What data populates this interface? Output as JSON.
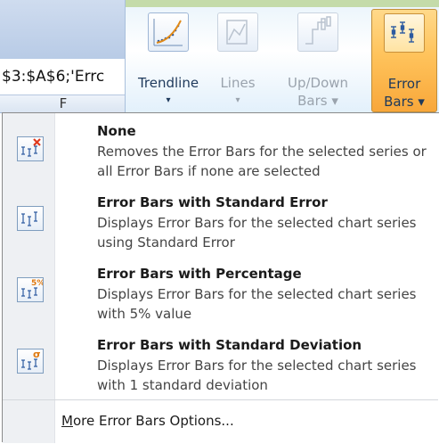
{
  "formula_bar": {
    "text": "$3:$A$6;'Errc"
  },
  "column_header": {
    "letter": "F"
  },
  "ribbon": {
    "buttons": [
      {
        "id": "trendline",
        "line1": "Trendline",
        "line2": "▾",
        "enabled": true,
        "icon": "trendline-icon"
      },
      {
        "id": "lines",
        "line1": "Lines",
        "line2": "▾",
        "enabled": false,
        "icon": "lines-icon"
      },
      {
        "id": "updown",
        "line1": "Up/Down",
        "line2": "Bars ▾",
        "enabled": false,
        "icon": "up-down-bars-icon"
      },
      {
        "id": "errorbars",
        "line1": "Error",
        "line2": "Bars ▾",
        "enabled": true,
        "selected": true,
        "icon": "error-bars-icon"
      }
    ]
  },
  "menu": {
    "items": [
      {
        "title": "None",
        "description": "Removes the Error Bars for the selected series or all Error Bars if none are selected",
        "icon": "error-bars-none-icon"
      },
      {
        "title": "Error Bars with Standard Error",
        "description": "Displays Error Bars for the selected chart series using Standard Error",
        "icon": "error-bars-standard-error-icon"
      },
      {
        "title": "Error Bars with Percentage",
        "description": "Displays Error Bars for the selected chart series with 5% value",
        "icon": "error-bars-percentage-icon",
        "icon_badge": "5%"
      },
      {
        "title": "Error Bars with Standard Deviation",
        "description": "Displays Error Bars for the selected chart series with 1 standard deviation",
        "icon": "error-bars-standard-deviation-icon",
        "icon_badge": "σ"
      }
    ],
    "more_options": {
      "accelerator": "M",
      "rest": "ore Error Bars Options..."
    }
  },
  "colors": {
    "ribbon_selected": "#ffc35b",
    "badge_red": "#e03a1e",
    "badge_orange": "#e07a10",
    "error_bar_blue": "#2c5aa0"
  }
}
